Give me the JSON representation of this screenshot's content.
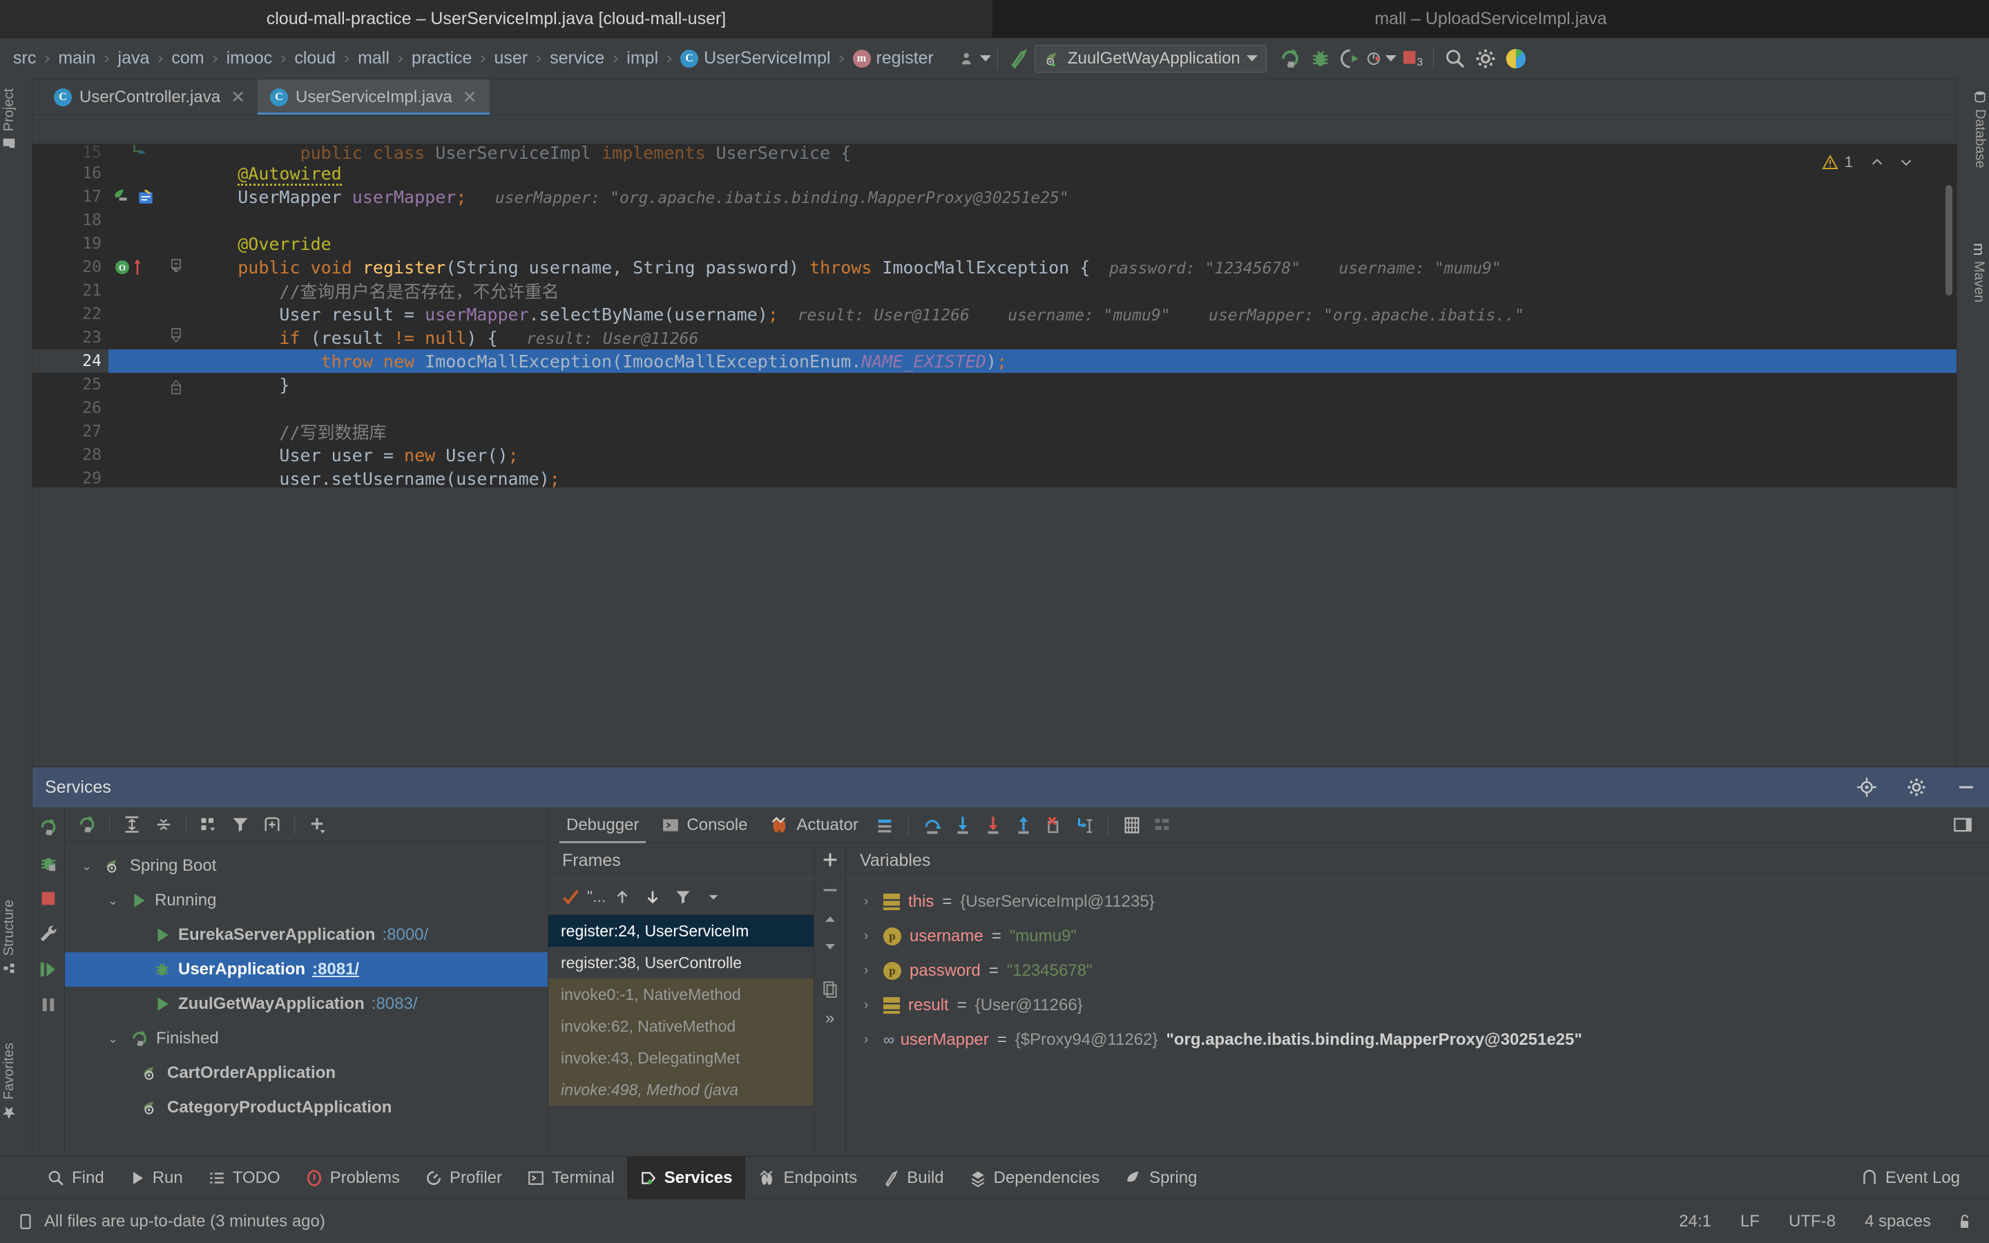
{
  "windows": {
    "active_title": "cloud-mall-practice – UserServiceImpl.java [cloud-mall-user]",
    "inactive_title": "mall – UploadServiceImpl.java"
  },
  "breadcrumb": {
    "items": [
      {
        "label": "src",
        "icon": ""
      },
      {
        "label": "main",
        "icon": ""
      },
      {
        "label": "java",
        "icon": ""
      },
      {
        "label": "com",
        "icon": ""
      },
      {
        "label": "imooc",
        "icon": ""
      },
      {
        "label": "cloud",
        "icon": ""
      },
      {
        "label": "mall",
        "icon": ""
      },
      {
        "label": "practice",
        "icon": ""
      },
      {
        "label": "user",
        "icon": ""
      },
      {
        "label": "service",
        "icon": ""
      },
      {
        "label": "impl",
        "icon": ""
      },
      {
        "label": "UserServiceImpl",
        "icon": "C"
      },
      {
        "label": "register",
        "icon": "m"
      }
    ],
    "separator": "›"
  },
  "toolbar": {
    "avatar_icon": "user-icon",
    "hammer_icon": "build-icon",
    "run_config": "ZuulGetWayApplication",
    "run_icon": "run-icon",
    "debug_icon": "debug-icon",
    "run_coverage_icon": "run-with-coverage-icon",
    "profiler_icon": "profiler-icon",
    "stop_icon": "stop-icon",
    "stop_count": "3",
    "search_icon": "search-everywhere-icon",
    "settings_icon": "settings-gear-icon",
    "updates_icon": "ide-updates-icon"
  },
  "editor_tabs": [
    {
      "label": "UserController.java",
      "icon": "C",
      "selected": false
    },
    {
      "label": "UserServiceImpl.java",
      "icon": "C",
      "selected": true
    }
  ],
  "left_strip": [
    {
      "label": "Project"
    },
    {
      "label": "Structure"
    },
    {
      "label": "Favorites"
    }
  ],
  "right_strip": [
    {
      "label": "Database"
    },
    {
      "label": "Maven"
    }
  ],
  "editor": {
    "warning_count": "1",
    "lines": [
      {
        "num": "15",
        "partial": true,
        "tokens": [
          {
            "c": "k",
            "s": "public "
          },
          {
            "c": "k",
            "s": "class "
          },
          {
            "c": "t",
            "s": "UserServiceImpl "
          },
          {
            "c": "k",
            "s": "implements "
          },
          {
            "c": "t",
            "s": "UserService {"
          }
        ]
      },
      {
        "num": "16",
        "tokens": [
          {
            "c": "pad",
            "s": "    "
          },
          {
            "c": "ann sq",
            "s": "@Autowired"
          }
        ]
      },
      {
        "num": "17",
        "gutter_icon": "override-implement-icon",
        "tokens": [
          {
            "c": "pad",
            "s": "    "
          },
          {
            "c": "t",
            "s": "UserMapper "
          },
          {
            "c": "fld",
            "s": "userMapper"
          },
          {
            "c": "k",
            "s": ";"
          },
          {
            "c": "hint",
            "s": "   userMapper: \"org.apache.ibatis.binding.MapperProxy@30251e25\""
          }
        ]
      },
      {
        "num": "18",
        "tokens": []
      },
      {
        "num": "19",
        "tokens": [
          {
            "c": "pad",
            "s": "    "
          },
          {
            "c": "ann",
            "s": "@Override"
          }
        ]
      },
      {
        "num": "20",
        "gutter_icon": "breakpoint-method-icon",
        "fold": "start",
        "tokens": [
          {
            "c": "pad",
            "s": "    "
          },
          {
            "c": "k",
            "s": "public "
          },
          {
            "c": "k",
            "s": "void "
          },
          {
            "c": "f",
            "s": "register"
          },
          {
            "c": "t",
            "s": "(String username, String password) "
          },
          {
            "c": "k",
            "s": "throws "
          },
          {
            "c": "t",
            "s": "ImoocMallException {"
          },
          {
            "c": "hint",
            "s": "  password: \"12345678\"    username: \"mumu9\""
          }
        ]
      },
      {
        "num": "21",
        "tokens": [
          {
            "c": "pad",
            "s": "        "
          },
          {
            "c": "cmt",
            "s": "//查询用户名是否存在，不允许重名"
          }
        ]
      },
      {
        "num": "22",
        "tokens": [
          {
            "c": "pad",
            "s": "        "
          },
          {
            "c": "t",
            "s": "User result = "
          },
          {
            "c": "fld",
            "s": "userMapper"
          },
          {
            "c": "t",
            "s": "."
          },
          {
            "c": "t",
            "s": "selectByName(username)"
          },
          {
            "c": "k",
            "s": ";"
          },
          {
            "c": "hint",
            "s": "  result: User@11266    username: \"mumu9\"    userMapper: \"org.apache.ibatis..\""
          }
        ]
      },
      {
        "num": "23",
        "fold": "mid",
        "tokens": [
          {
            "c": "pad",
            "s": "        "
          },
          {
            "c": "k",
            "s": "if "
          },
          {
            "c": "t",
            "s": "(result "
          },
          {
            "c": "k",
            "s": "!= "
          },
          {
            "c": "k",
            "s": "null"
          },
          {
            "c": "t",
            "s": ") {"
          },
          {
            "c": "hint",
            "s": "   result: User@11266"
          }
        ]
      },
      {
        "num": "24",
        "highlight": true,
        "tokens": [
          {
            "c": "pad",
            "s": "            "
          },
          {
            "c": "k",
            "s": "throw new "
          },
          {
            "c": "t",
            "s": "ImoocMallException(ImoocMallExceptionEnum."
          },
          {
            "c": "cst",
            "s": "NAME_EXISTED"
          },
          {
            "c": "t",
            "s": ")"
          },
          {
            "c": "k",
            "s": ";"
          }
        ]
      },
      {
        "num": "25",
        "fold": "end",
        "tokens": [
          {
            "c": "pad",
            "s": "        "
          },
          {
            "c": "t",
            "s": "}"
          }
        ]
      },
      {
        "num": "26",
        "tokens": []
      },
      {
        "num": "27",
        "tokens": [
          {
            "c": "pad",
            "s": "        "
          },
          {
            "c": "cmt",
            "s": "//写到数据库"
          }
        ]
      },
      {
        "num": "28",
        "tokens": [
          {
            "c": "pad",
            "s": "        "
          },
          {
            "c": "t",
            "s": "User user = "
          },
          {
            "c": "k",
            "s": "new "
          },
          {
            "c": "t",
            "s": "User()"
          },
          {
            "c": "k",
            "s": ";"
          }
        ]
      },
      {
        "num": "29",
        "tokens": [
          {
            "c": "pad",
            "s": "        "
          },
          {
            "c": "t",
            "s": "user.setUsername(username)"
          },
          {
            "c": "k",
            "s": ";"
          }
        ]
      }
    ]
  },
  "services": {
    "title": "Services",
    "header_icons": [
      "target-locate-icon",
      "settings-gear-icon",
      "minimize-icon"
    ],
    "tree_toolbar_icons": [
      "rerun-icon",
      "expand-all-icon",
      "collapse-all-icon",
      "group-by-icon",
      "filter-icon",
      "add-tab-icon",
      "add-service-icon"
    ],
    "side_icons": [
      "rerun-icon",
      "debug-icon",
      "stop-icon",
      "settings-wrench-icon",
      "resume-icon",
      "pause-icon",
      "more-icon"
    ],
    "tree": [
      {
        "label": "Spring Boot",
        "icon": "spring-icon",
        "depth": 0,
        "expander": "⌄",
        "selected": false,
        "port": ""
      },
      {
        "label": "Running",
        "icon": "run-green-icon",
        "depth": 1,
        "expander": "⌄",
        "selected": false,
        "port": ""
      },
      {
        "label": "EurekaServerApplication",
        "icon": "run-green-icon",
        "depth": 2,
        "expander": "",
        "selected": false,
        "port": ":8000/"
      },
      {
        "label": "UserApplication",
        "icon": "debug-green-icon",
        "depth": 2,
        "expander": "",
        "selected": true,
        "port": ":8081/"
      },
      {
        "label": "ZuulGetWayApplication",
        "icon": "run-green-icon",
        "depth": 2,
        "expander": "",
        "selected": false,
        "port": ":8083/"
      },
      {
        "label": "Finished",
        "icon": "rerun-icon",
        "depth": 1,
        "expander": "⌄",
        "selected": false,
        "port": ""
      },
      {
        "label": "CartOrderApplication",
        "icon": "spring-icon",
        "depth": 2,
        "expander": "",
        "selected": false,
        "port": ""
      },
      {
        "label": "CategoryProductApplication",
        "icon": "spring-icon",
        "depth": 2,
        "expander": "",
        "selected": false,
        "port": ""
      }
    ],
    "debugger_tabs": [
      {
        "label": "Debugger",
        "icon": "",
        "selected": true
      },
      {
        "label": "Console",
        "icon": "console-icon",
        "selected": false
      },
      {
        "label": "Actuator",
        "icon": "actuator-icon",
        "selected": false
      }
    ],
    "debugger_actions": [
      "layout-settings-icon",
      "step-over-icon",
      "step-into-icon",
      "force-step-into-icon",
      "step-out-icon",
      "drop-frame-icon",
      "run-to-cursor-icon",
      "evaluate-expression-icon",
      "mute-breakpoints-icon"
    ],
    "debugger_right_icon": "restore-layout-icon",
    "frames": {
      "title": "Frames",
      "toolbar_icons": [
        "thread-selector-icon",
        "up-icon",
        "down-icon",
        "filter-icon",
        "dropdown-icon"
      ],
      "thread_label": "\"...",
      "items": [
        {
          "label": "register:24, UserServiceIm",
          "kind": "sel"
        },
        {
          "label": "register:38, UserControlle",
          "kind": "own"
        },
        {
          "label": "invoke0:-1, NativeMethod",
          "kind": "lib"
        },
        {
          "label": "invoke:62, NativeMethod",
          "kind": "lib"
        },
        {
          "label": "invoke:43, DelegatingMet",
          "kind": "lib"
        },
        {
          "label": "invoke:498, Method (java",
          "kind": "lib"
        }
      ],
      "side_icons": [
        "add-icon",
        "remove-icon",
        "up-icon",
        "down-icon",
        "copy-icon",
        "more-icon"
      ]
    },
    "variables": {
      "title": "Variables",
      "items": [
        {
          "expander": "›",
          "icon": "field-icon",
          "name": "this",
          "eq": "=",
          "value": "{UserServiceImpl@11235}",
          "value_kind": "obj"
        },
        {
          "expander": "›",
          "icon": "param-icon",
          "name": "username",
          "eq": "=",
          "value": "\"mumu9\"",
          "value_kind": "str"
        },
        {
          "expander": "›",
          "icon": "param-icon",
          "name": "password",
          "eq": "=",
          "value": "\"12345678\"",
          "value_kind": "str"
        },
        {
          "expander": "›",
          "icon": "field-icon",
          "name": "result",
          "eq": "=",
          "value": "{User@11266}",
          "value_kind": "obj"
        },
        {
          "expander": "›",
          "icon": "glasses-icon",
          "name": "userMapper",
          "eq": "=",
          "value": "{$Proxy94@11262}",
          "value2": "\"org.apache.ibatis.binding.MapperProxy@30251e25\"",
          "value_kind": "obj"
        }
      ]
    }
  },
  "tool_windows": [
    {
      "label": "Find",
      "icon": "search-icon",
      "selected": false
    },
    {
      "label": "Run",
      "icon": "run-icon",
      "selected": false
    },
    {
      "label": "TODO",
      "icon": "todo-icon",
      "selected": false
    },
    {
      "label": "Problems",
      "icon": "problems-icon",
      "selected": false
    },
    {
      "label": "Profiler",
      "icon": "profiler-icon",
      "selected": false
    },
    {
      "label": "Terminal",
      "icon": "terminal-icon",
      "selected": false
    },
    {
      "label": "Services",
      "icon": "services-icon",
      "selected": true
    },
    {
      "label": "Endpoints",
      "icon": "endpoints-icon",
      "selected": false
    },
    {
      "label": "Build",
      "icon": "build-icon",
      "selected": false
    },
    {
      "label": "Dependencies",
      "icon": "dependencies-icon",
      "selected": false
    },
    {
      "label": "Spring",
      "icon": "spring-icon",
      "selected": false
    }
  ],
  "event_log": {
    "label": "Event Log",
    "icon": "event-log-icon"
  },
  "status": {
    "message": "All files are up-to-date (3 minutes ago)",
    "message_icon": "file-sync-icon",
    "caret": "24:1",
    "line_sep": "LF",
    "encoding": "UTF-8",
    "indent": "4 spaces",
    "lock_icon": "unlocked-icon"
  },
  "colors": {
    "accent_blue": "#2f65ab",
    "keyword_orange": "#cc7832",
    "string_green": "#6a8759",
    "field_purple": "#9876aa",
    "annotation_yellow": "#bbb529",
    "editor_bg": "#2b2b2b",
    "panel_bg": "#3c3f41"
  }
}
